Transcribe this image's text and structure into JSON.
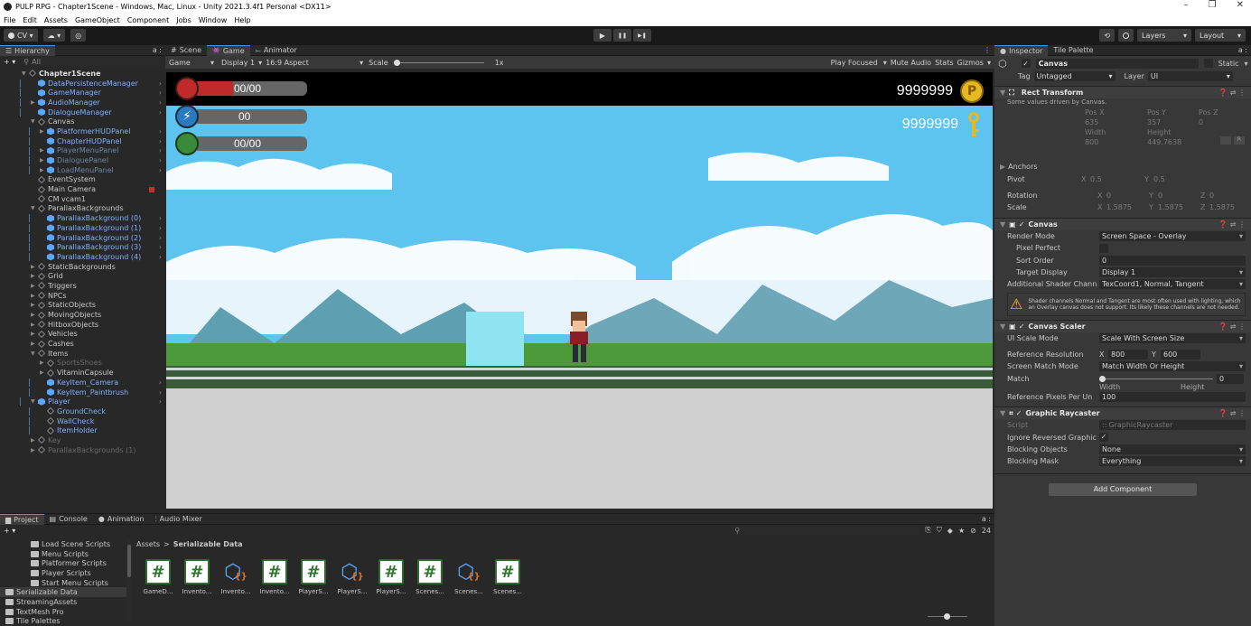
{
  "title_bar": {
    "title": "PULP RPG - Chapter1Scene - Windows, Mac, Linux - Unity 2021.3.4f1 Personal <DX11>",
    "minimize": "–",
    "maximize": "❐",
    "close": "✕"
  },
  "menu": [
    "File",
    "Edit",
    "Assets",
    "GameObject",
    "Component",
    "Jobs",
    "Window",
    "Help"
  ],
  "toolbar": {
    "account": "CV ▾",
    "cloud": "☁ ▾",
    "collab": "◎",
    "history": "⟲",
    "search": "🔍",
    "layers": "Layers",
    "layout": "Layout"
  },
  "hierarchy": {
    "tab": "Hierarchy",
    "lock": "a :",
    "add": "+ ▾",
    "search_placeholder": "All",
    "items": [
      {
        "label": "Chapter1Scene",
        "style": "bold",
        "depth": 0,
        "expander": "▼",
        "icon": "unity"
      },
      {
        "label": "DataPersistenceManager",
        "style": "blue",
        "depth": 1,
        "expander": "",
        "icon": "cube",
        "chev": true
      },
      {
        "label": "GameManager",
        "style": "blue",
        "depth": 1,
        "expander": "",
        "icon": "cube",
        "chev": true
      },
      {
        "label": "AudioManager",
        "style": "blue",
        "depth": 1,
        "expander": "▶",
        "icon": "cube",
        "chev": true
      },
      {
        "label": "DialogueManager",
        "style": "blue",
        "depth": 1,
        "expander": "",
        "icon": "cube",
        "chev": true
      },
      {
        "label": "Canvas",
        "style": "plain",
        "depth": 1,
        "expander": "▼",
        "icon": "cubeo"
      },
      {
        "label": "PlatformerHUDPanel",
        "style": "blue",
        "depth": 2,
        "expander": "▶",
        "icon": "cube",
        "chev": true
      },
      {
        "label": "ChapterHUDPanel",
        "style": "blue",
        "depth": 2,
        "expander": "",
        "icon": "cube",
        "chev": true
      },
      {
        "label": "PlayerMenuPanel",
        "style": "dim",
        "depth": 2,
        "expander": "▶",
        "icon": "cube",
        "chev": true
      },
      {
        "label": "DialoguePanel",
        "style": "dim",
        "depth": 2,
        "expander": "▶",
        "icon": "cube",
        "chev": true
      },
      {
        "label": "LoadMenuPanel",
        "style": "dim",
        "depth": 2,
        "expander": "▶",
        "icon": "cube",
        "chev": true
      },
      {
        "label": "EventSystem",
        "style": "plain",
        "depth": 1,
        "expander": "",
        "icon": "cubeo"
      },
      {
        "label": "Main Camera",
        "style": "plain",
        "depth": 1,
        "expander": "",
        "icon": "cubeo"
      },
      {
        "label": "CM vcam1",
        "style": "plain",
        "depth": 1,
        "expander": "",
        "icon": "cubeo"
      },
      {
        "label": "ParallaxBackgrounds",
        "style": "plain",
        "depth": 1,
        "expander": "▼",
        "icon": "cubeo"
      },
      {
        "label": "ParallaxBackground (0)",
        "style": "blue",
        "depth": 2,
        "expander": "",
        "icon": "cube",
        "chev": true
      },
      {
        "label": "ParallaxBackground (1)",
        "style": "blue",
        "depth": 2,
        "expander": "",
        "icon": "cube",
        "chev": true
      },
      {
        "label": "ParallaxBackground (2)",
        "style": "blue",
        "depth": 2,
        "expander": "",
        "icon": "cube",
        "chev": true
      },
      {
        "label": "ParallaxBackground (3)",
        "style": "blue",
        "depth": 2,
        "expander": "",
        "icon": "cube",
        "chev": true
      },
      {
        "label": "ParallaxBackground (4)",
        "style": "blue",
        "depth": 2,
        "expander": "",
        "icon": "cube",
        "chev": true
      },
      {
        "label": "StaticBackgrounds",
        "style": "plain",
        "depth": 1,
        "expander": "▶",
        "icon": "cubeo"
      },
      {
        "label": "Grid",
        "style": "plain",
        "depth": 1,
        "expander": "▶",
        "icon": "cubeo"
      },
      {
        "label": "Triggers",
        "style": "plain",
        "depth": 1,
        "expander": "▶",
        "icon": "cubeo"
      },
      {
        "label": "NPCs",
        "style": "plain",
        "depth": 1,
        "expander": "▶",
        "icon": "cubeo"
      },
      {
        "label": "StaticObjects",
        "style": "plain",
        "depth": 1,
        "expander": "▶",
        "icon": "cubeo"
      },
      {
        "label": "MovingObjects",
        "style": "plain",
        "depth": 1,
        "expander": "▶",
        "icon": "cubeo"
      },
      {
        "label": "HitboxObjects",
        "style": "plain",
        "depth": 1,
        "expander": "▶",
        "icon": "cubeo"
      },
      {
        "label": "Vehicles",
        "style": "plain",
        "depth": 1,
        "expander": "▶",
        "icon": "cubeo"
      },
      {
        "label": "Cashes",
        "style": "plain",
        "depth": 1,
        "expander": "▶",
        "icon": "cubeo"
      },
      {
        "label": "Items",
        "style": "plain",
        "depth": 1,
        "expander": "▼",
        "icon": "cubeo"
      },
      {
        "label": "SportsShoes",
        "style": "grey",
        "depth": 2,
        "expander": "▶",
        "icon": "cubeo"
      },
      {
        "label": "VitaminCapsule",
        "style": "plain",
        "depth": 2,
        "expander": "▶",
        "icon": "cubeo"
      },
      {
        "label": "KeyItem_Camera",
        "style": "blue",
        "depth": 2,
        "expander": "",
        "icon": "cube",
        "chev": true
      },
      {
        "label": "KeyItem_Paintbrush",
        "style": "blue",
        "depth": 2,
        "expander": "",
        "icon": "cube",
        "chev": true
      },
      {
        "label": "Player",
        "style": "blue",
        "depth": 1,
        "expander": "▼",
        "icon": "cube",
        "chev": true
      },
      {
        "label": "GroundCheck",
        "style": "blue",
        "depth": 2,
        "expander": "",
        "icon": "cubeo"
      },
      {
        "label": "WallCheck",
        "style": "blue",
        "depth": 2,
        "expander": "",
        "icon": "cubeo"
      },
      {
        "label": "ItemHolder",
        "style": "blue",
        "depth": 2,
        "expander": "",
        "icon": "cubeo"
      },
      {
        "label": "Key",
        "style": "grey",
        "depth": 1,
        "expander": "▶",
        "icon": "cubeo"
      },
      {
        "label": "ParallaxBackgrounds (1)",
        "style": "grey",
        "depth": 1,
        "expander": "▶",
        "icon": "cubeo"
      }
    ]
  },
  "center_tabs": [
    {
      "label": "Scene",
      "icon": "#",
      "active": false
    },
    {
      "label": "Game",
      "icon": "👾",
      "active": true
    },
    {
      "label": "Animator",
      "icon": "⤚",
      "active": false
    }
  ],
  "game_bar": {
    "view": "Game",
    "display": "Display 1",
    "aspect": "16:9 Aspect",
    "scale_label": "Scale",
    "scale_value": "1x",
    "play_focused": "Play Focused",
    "mute": "Mute Audio",
    "stats": "Stats",
    "gizmos": "Gizmos"
  },
  "hud": {
    "health": "00/00",
    "energy": "00",
    "food": "00/00",
    "coins": "9999999",
    "coin_symbol": "P",
    "keys": "9999999"
  },
  "play_controls": {
    "play": "▶",
    "pause": "❚❚",
    "step": "▶❚"
  },
  "inspector": {
    "tabs": [
      "Inspector",
      "Tile Palette"
    ],
    "object_name": "Canvas",
    "static_label": "Static",
    "tag_label": "Tag",
    "tag_value": "Untagged",
    "layer_label": "Layer",
    "layer_value": "UI",
    "rect_transform": {
      "title": "Rect Transform",
      "note": "Some values driven by Canvas.",
      "pos_x_label": "Pos X",
      "pos_y_label": "Pos Y",
      "pos_z_label": "Pos Z",
      "pos_x": "635",
      "pos_y": "357",
      "pos_z": "0",
      "width_label": "Width",
      "height_label": "Height",
      "width": "800",
      "height": "449.7638",
      "anchors": "Anchors",
      "pivot": "Pivot",
      "pivot_x": "0.5",
      "pivot_y": "0.5",
      "rotation": "Rotation",
      "rot_x": "0",
      "rot_y": "0",
      "rot_z": "0",
      "scale": "Scale",
      "scale_x": "1.5875",
      "scale_y": "1.5875",
      "scale_z": "1.5875",
      "x": "X",
      "y": "Y",
      "z": "Z",
      "r_btn": "R"
    },
    "canvas": {
      "title": "Canvas",
      "render_mode_label": "Render Mode",
      "render_mode": "Screen Space - Overlay",
      "pixel_perfect_label": "Pixel Perfect",
      "sort_order_label": "Sort Order",
      "sort_order": "0",
      "target_display_label": "Target Display",
      "target_display": "Display 1",
      "shader_label": "Additional Shader Chann",
      "shader_value": "TexCoord1, Normal, Tangent",
      "warning": "Shader channels Normal and Tangent are most often used with lighting, which an Overlay canvas does not support. Its likely these channels are not needed."
    },
    "scaler": {
      "title": "Canvas Scaler",
      "ui_scale_label": "UI Scale Mode",
      "ui_scale": "Scale With Screen Size",
      "ref_res_label": "Reference Resolution",
      "ref_x": "800",
      "ref_y": "600",
      "match_mode_label": "Screen Match Mode",
      "match_mode": "Match Width Or Height",
      "match_label": "Match",
      "match_value": "0",
      "match_width": "Width",
      "match_height": "Height",
      "ppu_label": "Reference Pixels Per Un",
      "ppu": "100"
    },
    "raycaster": {
      "title": "Graphic Raycaster",
      "script_label": "Script",
      "script": "GraphicRaycaster",
      "ignore_label": "Ignore Reversed Graphic",
      "blocking_objects_label": "Blocking Objects",
      "blocking_objects": "None",
      "blocking_mask_label": "Blocking Mask",
      "blocking_mask": "Everything"
    },
    "add_component": "Add Component"
  },
  "project": {
    "tabs": [
      {
        "label": "Project",
        "icon": "▆",
        "active": true
      },
      {
        "label": "Console",
        "icon": "▤",
        "active": false
      },
      {
        "label": "Animation",
        "icon": "●",
        "active": false
      },
      {
        "label": "Audio Mixer",
        "icon": "⫶",
        "active": false
      }
    ],
    "add": "+ ▾",
    "badge": "24",
    "breadcrumb_root": "Assets",
    "breadcrumb_sep": ">",
    "breadcrumb_current": "Serializable Data",
    "tree": [
      {
        "label": "Load Scene Scripts",
        "selected": false
      },
      {
        "label": "Menu Scripts",
        "selected": false
      },
      {
        "label": "Platformer Scripts",
        "selected": false
      },
      {
        "label": "Player Scripts",
        "selected": false
      },
      {
        "label": "Start Menu Scripts",
        "selected": false
      },
      {
        "label": "Serializable Data",
        "selected": true
      },
      {
        "label": "StreamingAssets",
        "selected": false
      },
      {
        "label": "TextMesh Pro",
        "selected": false
      },
      {
        "label": "Tile Palettes",
        "selected": false
      }
    ],
    "assets": [
      {
        "label": "GameD...",
        "kind": "script"
      },
      {
        "label": "Invento...",
        "kind": "script"
      },
      {
        "label": "Invento...",
        "kind": "json"
      },
      {
        "label": "Invento...",
        "kind": "script"
      },
      {
        "label": "PlayerS...",
        "kind": "script"
      },
      {
        "label": "PlayerS...",
        "kind": "json"
      },
      {
        "label": "PlayerS...",
        "kind": "script"
      },
      {
        "label": "Scenes...",
        "kind": "script"
      },
      {
        "label": "Scenes...",
        "kind": "json"
      },
      {
        "label": "Scenes...",
        "kind": "script"
      }
    ]
  },
  "colors": {
    "accent": "#4d90ff",
    "prefab": "#7fb0ff",
    "sky": "#5fc3f0",
    "ground": "#d0d0d0",
    "health": "#c02a2a"
  }
}
